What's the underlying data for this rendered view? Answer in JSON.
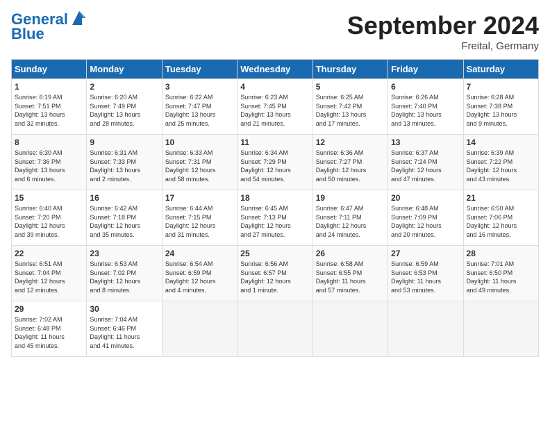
{
  "header": {
    "logo_line1": "General",
    "logo_line2": "Blue",
    "month": "September 2024",
    "location": "Freital, Germany"
  },
  "days_of_week": [
    "Sunday",
    "Monday",
    "Tuesday",
    "Wednesday",
    "Thursday",
    "Friday",
    "Saturday"
  ],
  "weeks": [
    [
      {
        "day": "1",
        "info": "Sunrise: 6:19 AM\nSunset: 7:51 PM\nDaylight: 13 hours\nand 32 minutes."
      },
      {
        "day": "2",
        "info": "Sunrise: 6:20 AM\nSunset: 7:49 PM\nDaylight: 13 hours\nand 28 minutes."
      },
      {
        "day": "3",
        "info": "Sunrise: 6:22 AM\nSunset: 7:47 PM\nDaylight: 13 hours\nand 25 minutes."
      },
      {
        "day": "4",
        "info": "Sunrise: 6:23 AM\nSunset: 7:45 PM\nDaylight: 13 hours\nand 21 minutes."
      },
      {
        "day": "5",
        "info": "Sunrise: 6:25 AM\nSunset: 7:42 PM\nDaylight: 13 hours\nand 17 minutes."
      },
      {
        "day": "6",
        "info": "Sunrise: 6:26 AM\nSunset: 7:40 PM\nDaylight: 13 hours\nand 13 minutes."
      },
      {
        "day": "7",
        "info": "Sunrise: 6:28 AM\nSunset: 7:38 PM\nDaylight: 13 hours\nand 9 minutes."
      }
    ],
    [
      {
        "day": "8",
        "info": "Sunrise: 6:30 AM\nSunset: 7:36 PM\nDaylight: 13 hours\nand 6 minutes."
      },
      {
        "day": "9",
        "info": "Sunrise: 6:31 AM\nSunset: 7:33 PM\nDaylight: 13 hours\nand 2 minutes."
      },
      {
        "day": "10",
        "info": "Sunrise: 6:33 AM\nSunset: 7:31 PM\nDaylight: 12 hours\nand 58 minutes."
      },
      {
        "day": "11",
        "info": "Sunrise: 6:34 AM\nSunset: 7:29 PM\nDaylight: 12 hours\nand 54 minutes."
      },
      {
        "day": "12",
        "info": "Sunrise: 6:36 AM\nSunset: 7:27 PM\nDaylight: 12 hours\nand 50 minutes."
      },
      {
        "day": "13",
        "info": "Sunrise: 6:37 AM\nSunset: 7:24 PM\nDaylight: 12 hours\nand 47 minutes."
      },
      {
        "day": "14",
        "info": "Sunrise: 6:39 AM\nSunset: 7:22 PM\nDaylight: 12 hours\nand 43 minutes."
      }
    ],
    [
      {
        "day": "15",
        "info": "Sunrise: 6:40 AM\nSunset: 7:20 PM\nDaylight: 12 hours\nand 39 minutes."
      },
      {
        "day": "16",
        "info": "Sunrise: 6:42 AM\nSunset: 7:18 PM\nDaylight: 12 hours\nand 35 minutes."
      },
      {
        "day": "17",
        "info": "Sunrise: 6:44 AM\nSunset: 7:15 PM\nDaylight: 12 hours\nand 31 minutes."
      },
      {
        "day": "18",
        "info": "Sunrise: 6:45 AM\nSunset: 7:13 PM\nDaylight: 12 hours\nand 27 minutes."
      },
      {
        "day": "19",
        "info": "Sunrise: 6:47 AM\nSunset: 7:11 PM\nDaylight: 12 hours\nand 24 minutes."
      },
      {
        "day": "20",
        "info": "Sunrise: 6:48 AM\nSunset: 7:09 PM\nDaylight: 12 hours\nand 20 minutes."
      },
      {
        "day": "21",
        "info": "Sunrise: 6:50 AM\nSunset: 7:06 PM\nDaylight: 12 hours\nand 16 minutes."
      }
    ],
    [
      {
        "day": "22",
        "info": "Sunrise: 6:51 AM\nSunset: 7:04 PM\nDaylight: 12 hours\nand 12 minutes."
      },
      {
        "day": "23",
        "info": "Sunrise: 6:53 AM\nSunset: 7:02 PM\nDaylight: 12 hours\nand 8 minutes."
      },
      {
        "day": "24",
        "info": "Sunrise: 6:54 AM\nSunset: 6:59 PM\nDaylight: 12 hours\nand 4 minutes."
      },
      {
        "day": "25",
        "info": "Sunrise: 6:56 AM\nSunset: 6:57 PM\nDaylight: 12 hours\nand 1 minute."
      },
      {
        "day": "26",
        "info": "Sunrise: 6:58 AM\nSunset: 6:55 PM\nDaylight: 11 hours\nand 57 minutes."
      },
      {
        "day": "27",
        "info": "Sunrise: 6:59 AM\nSunset: 6:53 PM\nDaylight: 11 hours\nand 53 minutes."
      },
      {
        "day": "28",
        "info": "Sunrise: 7:01 AM\nSunset: 6:50 PM\nDaylight: 11 hours\nand 49 minutes."
      }
    ],
    [
      {
        "day": "29",
        "info": "Sunrise: 7:02 AM\nSunset: 6:48 PM\nDaylight: 11 hours\nand 45 minutes."
      },
      {
        "day": "30",
        "info": "Sunrise: 7:04 AM\nSunset: 6:46 PM\nDaylight: 11 hours\nand 41 minutes."
      },
      {
        "day": "",
        "info": ""
      },
      {
        "day": "",
        "info": ""
      },
      {
        "day": "",
        "info": ""
      },
      {
        "day": "",
        "info": ""
      },
      {
        "day": "",
        "info": ""
      }
    ]
  ]
}
